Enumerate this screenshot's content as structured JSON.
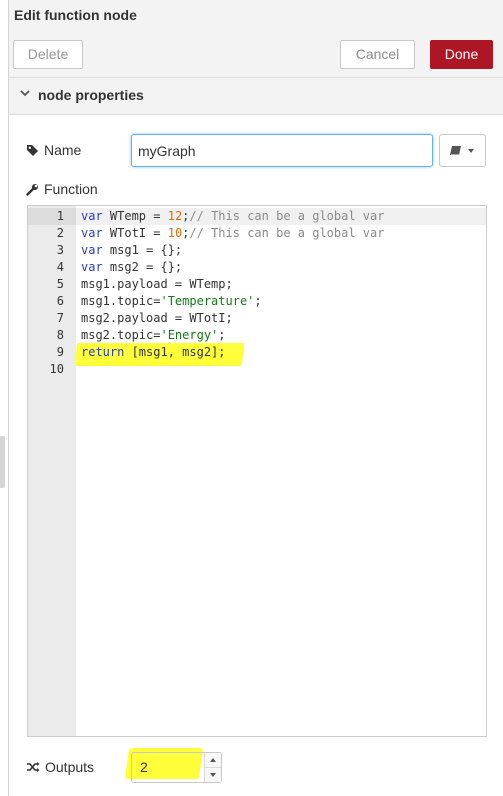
{
  "header": {
    "title": "Edit function node",
    "delete_label": "Delete",
    "cancel_label": "Cancel",
    "done_label": "Done"
  },
  "section": {
    "label": "node properties"
  },
  "name": {
    "label": "Name",
    "value": "myGraph"
  },
  "function": {
    "label": "Function",
    "lines": [
      {
        "num": "1",
        "code": "var WTemp = 12;// This can be a global var"
      },
      {
        "num": "2",
        "code": "var WTotI = 10;// This can be a global var"
      },
      {
        "num": "3",
        "code": "var msg1 = {};"
      },
      {
        "num": "4",
        "code": "var msg2 = {};"
      },
      {
        "num": "5",
        "code": "msg1.payload = WTemp;"
      },
      {
        "num": "6",
        "code": "msg1.topic='Temperature';"
      },
      {
        "num": "7",
        "code": "msg2.payload = WTotI;"
      },
      {
        "num": "8",
        "code": "msg2.topic='Energy';"
      },
      {
        "num": "9",
        "code": "return [msg1, msg2];"
      },
      {
        "num": "10",
        "code": ""
      }
    ]
  },
  "outputs": {
    "label": "Outputs",
    "value": "2"
  },
  "colors": {
    "done_button": "#ad1625",
    "highlight": "#ffff3a",
    "input_focus": "#66afe9"
  },
  "icons": [
    "chevron-down-icon",
    "tag-icon",
    "wrench-icon",
    "book-icon",
    "caret-down-icon",
    "shuffle-icon",
    "spin-up-icon",
    "spin-down-icon"
  ]
}
